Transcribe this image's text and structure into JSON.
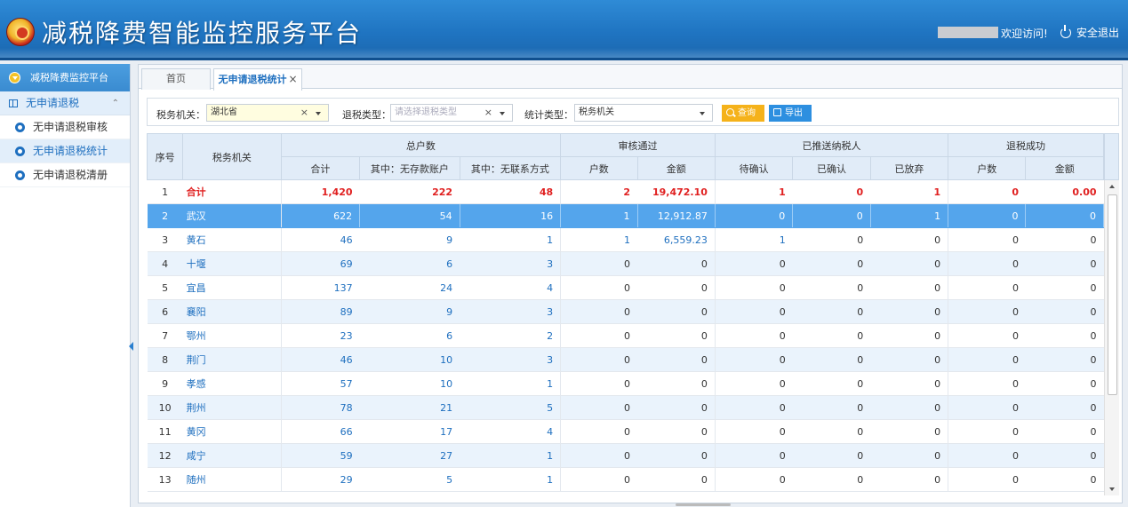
{
  "header": {
    "title": "减税降费智能监控服务平台",
    "welcome": "欢迎访问!",
    "logout": "安全退出"
  },
  "sidebar": {
    "title": "减税降费监控平台",
    "group": "无申请退税",
    "items": [
      {
        "label": "无申请退税审核"
      },
      {
        "label": "无申请退税统计"
      },
      {
        "label": "无申请退税清册"
      }
    ]
  },
  "tabs": {
    "home": "首页",
    "current": "无申请退税统计",
    "close": "×"
  },
  "filters": {
    "tax_office_label": "税务机关：",
    "tax_office_value": "湖北省",
    "refund_type_label": "退税类型：",
    "refund_type_placeholder": "请选择退税类型",
    "stat_type_label": "统计类型：",
    "stat_type_value": "税务机关",
    "clear": "×",
    "query_button": "查询",
    "export_button": "导出"
  },
  "table": {
    "headers": {
      "seq": "序号",
      "office": "税务机关",
      "total_group": "总户数",
      "audit_group": "审核通过",
      "pushed_group": "已推送纳税人",
      "success_group": "退税成功",
      "total": "合计",
      "no_deposit": "其中：无存款账户",
      "no_contact": "其中：无联系方式",
      "audit_count": "户数",
      "audit_amount": "金额",
      "pending": "待确认",
      "confirmed": "已确认",
      "abandoned": "已放弃",
      "success_count": "户数",
      "success_amount": "金额"
    },
    "rows": [
      {
        "seq": "1",
        "office": "合计",
        "total": "1,420",
        "no_deposit": "222",
        "no_contact": "48",
        "audit_count": "2",
        "audit_amount": "19,472.10",
        "pending": "1",
        "confirmed": "0",
        "abandoned": "1",
        "success_count": "0",
        "success_amount": "0.00"
      },
      {
        "seq": "2",
        "office": "武汉",
        "total": "622",
        "no_deposit": "54",
        "no_contact": "16",
        "audit_count": "1",
        "audit_amount": "12,912.87",
        "pending": "0",
        "confirmed": "0",
        "abandoned": "1",
        "success_count": "0",
        "success_amount": "0"
      },
      {
        "seq": "3",
        "office": "黄石",
        "total": "46",
        "no_deposit": "9",
        "no_contact": "1",
        "audit_count": "1",
        "audit_amount": "6,559.23",
        "pending": "1",
        "confirmed": "0",
        "abandoned": "0",
        "success_count": "0",
        "success_amount": "0"
      },
      {
        "seq": "4",
        "office": "十堰",
        "total": "69",
        "no_deposit": "6",
        "no_contact": "3",
        "audit_count": "0",
        "audit_amount": "0",
        "pending": "0",
        "confirmed": "0",
        "abandoned": "0",
        "success_count": "0",
        "success_amount": "0"
      },
      {
        "seq": "5",
        "office": "宜昌",
        "total": "137",
        "no_deposit": "24",
        "no_contact": "4",
        "audit_count": "0",
        "audit_amount": "0",
        "pending": "0",
        "confirmed": "0",
        "abandoned": "0",
        "success_count": "0",
        "success_amount": "0"
      },
      {
        "seq": "6",
        "office": "襄阳",
        "total": "89",
        "no_deposit": "9",
        "no_contact": "3",
        "audit_count": "0",
        "audit_amount": "0",
        "pending": "0",
        "confirmed": "0",
        "abandoned": "0",
        "success_count": "0",
        "success_amount": "0"
      },
      {
        "seq": "7",
        "office": "鄂州",
        "total": "23",
        "no_deposit": "6",
        "no_contact": "2",
        "audit_count": "0",
        "audit_amount": "0",
        "pending": "0",
        "confirmed": "0",
        "abandoned": "0",
        "success_count": "0",
        "success_amount": "0"
      },
      {
        "seq": "8",
        "office": "荆门",
        "total": "46",
        "no_deposit": "10",
        "no_contact": "3",
        "audit_count": "0",
        "audit_amount": "0",
        "pending": "0",
        "confirmed": "0",
        "abandoned": "0",
        "success_count": "0",
        "success_amount": "0"
      },
      {
        "seq": "9",
        "office": "孝感",
        "total": "57",
        "no_deposit": "10",
        "no_contact": "1",
        "audit_count": "0",
        "audit_amount": "0",
        "pending": "0",
        "confirmed": "0",
        "abandoned": "0",
        "success_count": "0",
        "success_amount": "0"
      },
      {
        "seq": "10",
        "office": "荆州",
        "total": "78",
        "no_deposit": "21",
        "no_contact": "5",
        "audit_count": "0",
        "audit_amount": "0",
        "pending": "0",
        "confirmed": "0",
        "abandoned": "0",
        "success_count": "0",
        "success_amount": "0"
      },
      {
        "seq": "11",
        "office": "黄冈",
        "total": "66",
        "no_deposit": "17",
        "no_contact": "4",
        "audit_count": "0",
        "audit_amount": "0",
        "pending": "0",
        "confirmed": "0",
        "abandoned": "0",
        "success_count": "0",
        "success_amount": "0"
      },
      {
        "seq": "12",
        "office": "咸宁",
        "total": "59",
        "no_deposit": "27",
        "no_contact": "1",
        "audit_count": "0",
        "audit_amount": "0",
        "pending": "0",
        "confirmed": "0",
        "abandoned": "0",
        "success_count": "0",
        "success_amount": "0"
      },
      {
        "seq": "13",
        "office": "随州",
        "total": "29",
        "no_deposit": "5",
        "no_contact": "1",
        "audit_count": "0",
        "audit_amount": "0",
        "pending": "0",
        "confirmed": "0",
        "abandoned": "0",
        "success_count": "0",
        "success_amount": "0"
      }
    ]
  }
}
